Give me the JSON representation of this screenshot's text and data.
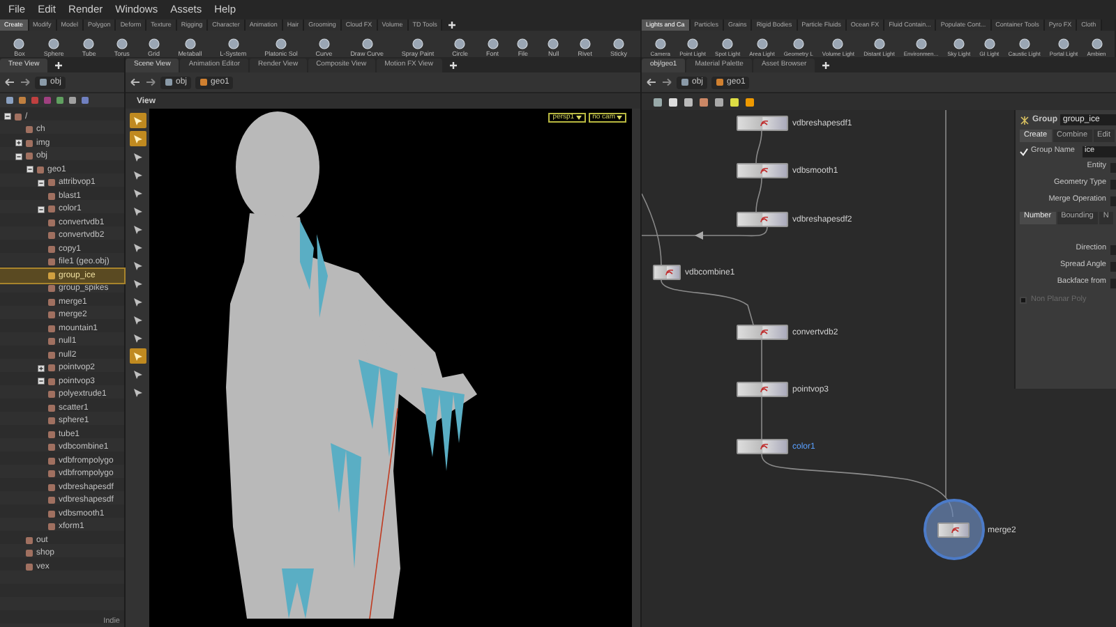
{
  "menu": [
    "File",
    "Edit",
    "Render",
    "Windows",
    "Assets",
    "Help"
  ],
  "shelf_left": {
    "tabs": [
      {
        "label": "Create",
        "selected": true
      },
      {
        "label": "Modify",
        "selected": false
      },
      {
        "label": "Model",
        "selected": false
      },
      {
        "label": "Polygon",
        "selected": false
      },
      {
        "label": "Deform",
        "selected": false
      },
      {
        "label": "Texture",
        "selected": false
      },
      {
        "label": "Rigging",
        "selected": false
      },
      {
        "label": "Character",
        "selected": false
      },
      {
        "label": "Animation",
        "selected": false
      },
      {
        "label": "Hair",
        "selected": false
      },
      {
        "label": "Grooming",
        "selected": false
      },
      {
        "label": "Cloud FX",
        "selected": false
      },
      {
        "label": "Volume",
        "selected": false
      },
      {
        "label": "TD Tools",
        "selected": false
      }
    ],
    "tools": [
      "Box",
      "Sphere",
      "Tube",
      "Torus",
      "Grid",
      "Metaball",
      "L-System",
      "Platonic Sol",
      "Curve",
      "Draw Curve",
      "Spray Paint",
      "Circle",
      "Font",
      "File",
      "Null",
      "Rivet",
      "Sticky"
    ]
  },
  "shelf_right": {
    "tabs": [
      {
        "label": "Lights and Ca",
        "selected": true
      },
      {
        "label": "Particles",
        "selected": false
      },
      {
        "label": "Grains",
        "selected": false
      },
      {
        "label": "Rigid Bodies",
        "selected": false
      },
      {
        "label": "Particle Fluids",
        "selected": false
      },
      {
        "label": "Ocean FX",
        "selected": false
      },
      {
        "label": "Fluid Contain...",
        "selected": false
      },
      {
        "label": "Populate Cont...",
        "selected": false
      },
      {
        "label": "Container Tools",
        "selected": false
      },
      {
        "label": "Pyro FX",
        "selected": false
      },
      {
        "label": "Cloth",
        "selected": false
      }
    ],
    "tools": [
      "Camera",
      "Point Light",
      "Spot Light",
      "Area Light",
      "Geometry L",
      "Volume Light",
      "Distant Light",
      "Environmen...",
      "Sky Light",
      "GI Light",
      "Caustic Light",
      "Portal Light",
      "Ambien"
    ]
  },
  "tree_pane": {
    "tabs": [
      {
        "label": "Tree View",
        "selected": true
      }
    ],
    "path": "obj",
    "tree": [
      {
        "label": "/",
        "selected": false,
        "expanded": true,
        "children": [
          {
            "label": "ch",
            "selected": false
          },
          {
            "label": "img",
            "selected": false,
            "expanded": false
          },
          {
            "label": "obj",
            "selected": false,
            "expanded": true,
            "children": [
              {
                "label": "geo1",
                "selected": false,
                "expanded": true,
                "children": [
                  {
                    "label": "attribvop1",
                    "selected": false,
                    "expanded": true
                  },
                  {
                    "label": "blast1",
                    "selected": false
                  },
                  {
                    "label": "color1",
                    "selected": false,
                    "expanded": true
                  },
                  {
                    "label": "convertvdb1",
                    "selected": false
                  },
                  {
                    "label": "convertvdb2",
                    "selected": false
                  },
                  {
                    "label": "copy1",
                    "selected": false
                  },
                  {
                    "label": "file1 (geo.obj)",
                    "selected": false
                  },
                  {
                    "label": "group_ice",
                    "selected": true
                  },
                  {
                    "label": "group_spikes",
                    "selected": false
                  },
                  {
                    "label": "merge1",
                    "selected": false
                  },
                  {
                    "label": "merge2",
                    "selected": false
                  },
                  {
                    "label": "mountain1",
                    "selected": false
                  },
                  {
                    "label": "null1",
                    "selected": false
                  },
                  {
                    "label": "null2",
                    "selected": false
                  },
                  {
                    "label": "pointvop2",
                    "selected": false,
                    "expanded": false
                  },
                  {
                    "label": "pointvop3",
                    "selected": false,
                    "expanded": true
                  },
                  {
                    "label": "polyextrude1",
                    "selected": false
                  },
                  {
                    "label": "scatter1",
                    "selected": false
                  },
                  {
                    "label": "sphere1",
                    "selected": false
                  },
                  {
                    "label": "tube1",
                    "selected": false
                  },
                  {
                    "label": "vdbcombine1",
                    "selected": false
                  },
                  {
                    "label": "vdbfrompolygo",
                    "selected": false
                  },
                  {
                    "label": "vdbfrompolygo",
                    "selected": false
                  },
                  {
                    "label": "vdbreshapesdf",
                    "selected": false
                  },
                  {
                    "label": "vdbreshapesdf",
                    "selected": false
                  },
                  {
                    "label": "vdbsmooth1",
                    "selected": false
                  },
                  {
                    "label": "xform1",
                    "selected": false
                  }
                ]
              }
            ]
          },
          {
            "label": "out",
            "selected": false
          },
          {
            "label": "shop",
            "selected": false
          },
          {
            "label": "vex",
            "selected": false
          }
        ]
      }
    ],
    "license": "Indie"
  },
  "viewport_pane": {
    "tabs": [
      {
        "label": "Scene View",
        "selected": true
      },
      {
        "label": "Animation Editor",
        "selected": false
      },
      {
        "label": "Render View",
        "selected": false
      },
      {
        "label": "Composite View",
        "selected": false
      },
      {
        "label": "Motion FX View",
        "selected": false
      }
    ],
    "path": [
      "obj",
      "geo1"
    ],
    "header": "View",
    "camera_menus": [
      "persp1",
      "no cam"
    ],
    "tools": [
      {
        "active": true
      },
      {
        "active": true
      },
      {
        "active": false
      },
      {
        "active": false
      },
      {
        "active": false
      },
      {
        "active": false
      },
      {
        "active": false
      },
      {
        "active": false
      },
      {
        "active": false
      },
      {
        "active": false
      },
      {
        "active": false
      },
      {
        "active": false
      },
      {
        "active": false
      },
      {
        "active": true
      },
      {
        "active": false
      },
      {
        "active": false
      }
    ]
  },
  "network_pane": {
    "tabs": [
      {
        "label": "obj/geo1",
        "selected": true
      },
      {
        "label": "Material Palette",
        "selected": false
      },
      {
        "label": "Asset Browser",
        "selected": false
      }
    ],
    "path": [
      "obj",
      "geo1"
    ],
    "nodes": [
      {
        "label": "vdbreshapesdf1",
        "selected": false,
        "highlighted": false
      },
      {
        "label": "vdbsmooth1",
        "selected": false,
        "highlighted": false
      },
      {
        "label": "vdbreshapesdf2",
        "selected": false,
        "highlighted": false
      },
      {
        "label": "vdbcombine1",
        "selected": false,
        "highlighted": false
      },
      {
        "label": "convertvdb2",
        "selected": false,
        "highlighted": false
      },
      {
        "label": "pointvop3",
        "selected": false,
        "highlighted": false
      },
      {
        "label": "color1",
        "selected": true,
        "highlighted": false
      },
      {
        "label": "merge2",
        "selected": false,
        "highlighted": true
      }
    ],
    "parameters": {
      "node_type": "Group",
      "node_name": "group_ice",
      "tabs": [
        {
          "label": "Create",
          "selected": true
        },
        {
          "label": "Combine",
          "selected": false
        },
        {
          "label": "Edit",
          "selected": false
        }
      ],
      "group_name": {
        "label": "Group Name",
        "checked": true,
        "value": "ice"
      },
      "fields": [
        "Entity",
        "Geometry Type",
        "Merge Operation"
      ],
      "subtabs": [
        {
          "label": "Number",
          "selected": true
        },
        {
          "label": "Bounding",
          "selected": false
        },
        {
          "label": "N",
          "selected": false
        }
      ],
      "subfields": [
        "Direction",
        "Spread Angle",
        "Backface from"
      ],
      "option": {
        "label": "Non Planar Poly",
        "checked": false,
        "disabled": true
      }
    }
  }
}
